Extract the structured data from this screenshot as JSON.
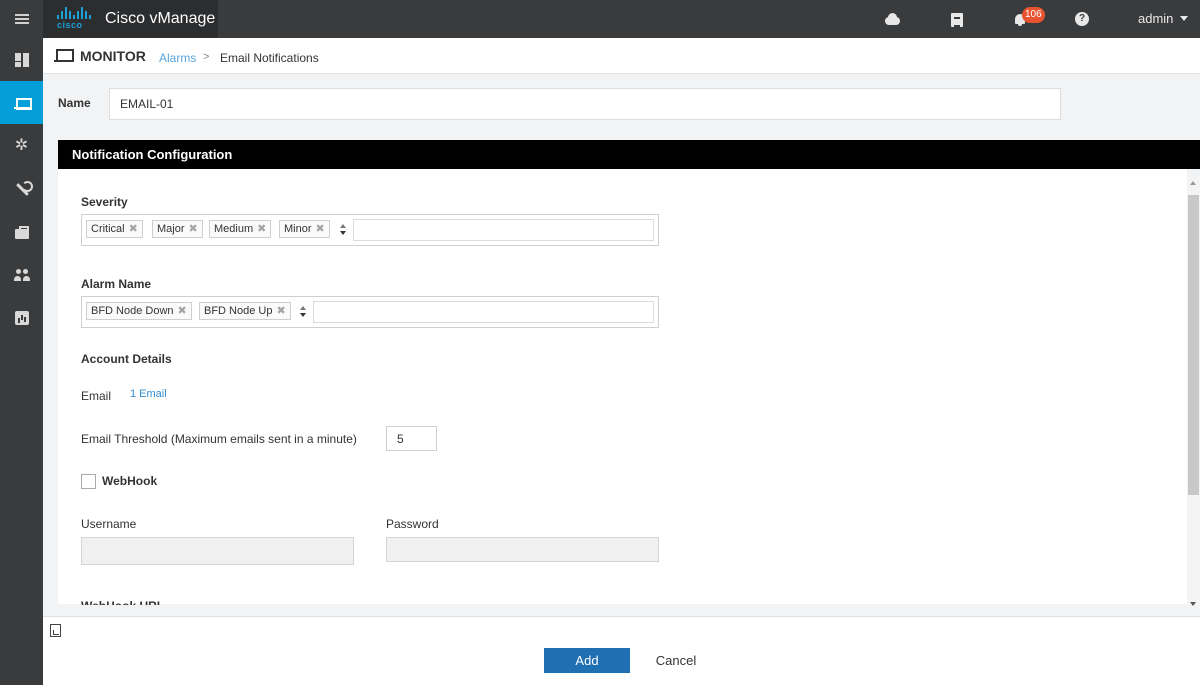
{
  "app": {
    "brand_name": "Cisco vManage",
    "logo_word": "cisco",
    "notification_count": "106",
    "help_glyph": "?",
    "user": "admin"
  },
  "sidebar": {
    "items": [
      {
        "icon": "dashboard-icon"
      },
      {
        "icon": "monitor-icon",
        "active": true
      },
      {
        "icon": "gear-icon",
        "glyph": "✲"
      },
      {
        "icon": "wrench-icon"
      },
      {
        "icon": "briefcase-icon"
      },
      {
        "icon": "users-icon"
      },
      {
        "icon": "analytics-icon"
      }
    ]
  },
  "breadcrumb": {
    "section": "MONITOR",
    "parent": "Alarms",
    "separator": ">",
    "current": "Email Notifications"
  },
  "form": {
    "name_label": "Name",
    "name_value": "EMAIL-01",
    "panel_title": "Notification Configuration",
    "severity_label": "Severity",
    "severity_tags": [
      "Critical",
      "Major",
      "Medium",
      "Minor"
    ],
    "alarm_name_label": "Alarm Name",
    "alarm_tags": [
      "BFD Node Down",
      "BFD Node Up"
    ],
    "tag_remove_glyph": "✖",
    "account_details_label": "Account Details",
    "email_label": "Email",
    "email_link": "1 Email",
    "threshold_label": "Email Threshold (Maximum emails sent in a minute)",
    "threshold_value": "5",
    "webhook_label": "WebHook",
    "username_label": "Username",
    "password_label": "Password",
    "webhook_url_label": "WebHook URL"
  },
  "footer": {
    "add_label": "Add",
    "cancel_label": "Cancel"
  },
  "colors": {
    "topbar": "#3a3b3d",
    "active_nav": "#049fd9",
    "primary_button": "#1f6fb3",
    "link": "#2f8ed1",
    "badge": "#e8542f"
  }
}
